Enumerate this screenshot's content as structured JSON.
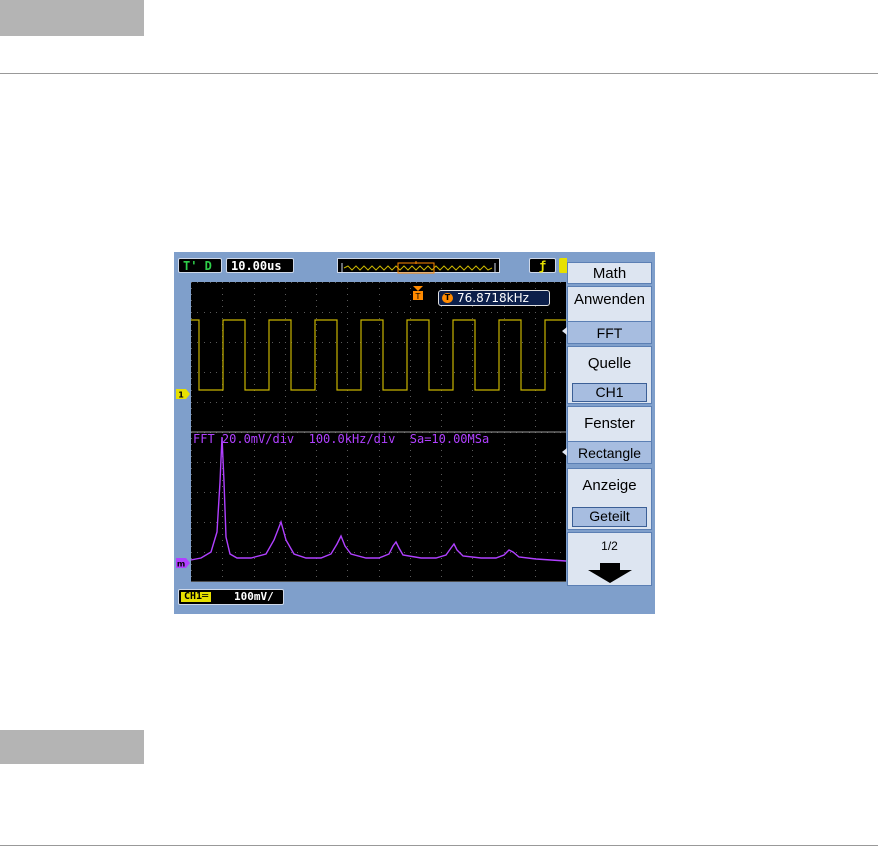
{
  "scope": {
    "status_mode": "T' D",
    "timebase": "10.00us",
    "trigger_slope_glyph": "ƒ",
    "frequency_readout": "76.8718kHz",
    "trigger_icon": "T",
    "ch1_marker": "1",
    "math_marker": "m",
    "fft_header": "FFT 20.0mV/div  100.0kHz/div  Sa=10.00MSa",
    "ch1_tag": "CH1",
    "ch1_coupling_glyph": "═",
    "ch1_scale": "100mV/",
    "colors": {
      "bezel": "#7f9fcb",
      "ch1_trace": "#c8b400",
      "math_trace": "#b040ff",
      "trigger_marker": "#ff8a00"
    }
  },
  "menu": {
    "title": "Math",
    "operation_label": "Anwenden",
    "operation_value": "FFT",
    "source_label": "Quelle",
    "source_value": "CH1",
    "window_label": "Fenster",
    "window_value": "Rectangle",
    "display_label": "Anzeige",
    "display_value": "Geteilt",
    "page_indicator": "1/2",
    "next_page_icon": "down-arrow-icon"
  }
}
